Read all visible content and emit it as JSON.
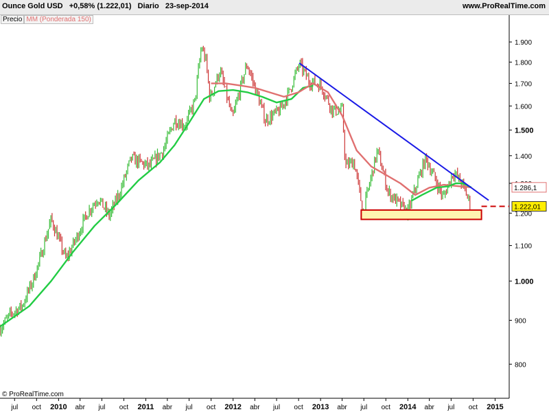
{
  "header": {
    "instrument": "Ounce Gold USD",
    "change": "+0,58% (1.222,01)",
    "period": "Diario",
    "date": "23-sep-2014",
    "site": "www.ProRealTime.com"
  },
  "legend": {
    "price": "Precio",
    "ma": "MM (Ponderada 150)"
  },
  "copyright": "© ProRealTime.com",
  "colors": {
    "ma_green": "#22cc44",
    "ma_red": "#e07070",
    "trendline": "#1a1ae6",
    "support": "#cc0000",
    "support_fill": "#fff4b0",
    "candle_up": "#33bb33",
    "candle_down": "#cc3333"
  },
  "chart_data": {
    "type": "line",
    "title": "Ounce Gold USD",
    "x_range": [
      "2009-05",
      "2015-03"
    ],
    "ylim": [
      730,
      1990
    ],
    "y_scale": "log",
    "grid": false,
    "price_series": {
      "name": "Precio",
      "x": [
        "2009-05-01",
        "2009-06-15",
        "2009-08-01",
        "2009-09-15",
        "2009-10-15",
        "2009-12-01",
        "2010-02-01",
        "2010-03-15",
        "2010-05-01",
        "2010-06-15",
        "2010-08-01",
        "2010-09-15",
        "2010-11-01",
        "2011-01-15",
        "2011-03-15",
        "2011-05-01",
        "2011-06-15",
        "2011-07-25",
        "2011-08-22",
        "2011-09-10",
        "2011-09-26",
        "2011-11-07",
        "2011-12-29",
        "2012-02-28",
        "2012-05-15",
        "2012-07-15",
        "2012-08-22",
        "2012-10-04",
        "2012-11-15",
        "2013-01-02",
        "2013-02-20",
        "2013-04-02",
        "2013-04-15",
        "2013-05-20",
        "2013-06-28",
        "2013-08-27",
        "2013-10-10",
        "2013-12-31",
        "2014-02-20",
        "2014-03-17",
        "2014-05-29",
        "2014-07-10",
        "2014-08-15",
        "2014-09-23"
      ],
      "values": [
        880,
        915,
        935,
        1000,
        1060,
        1180,
        1060,
        1120,
        1200,
        1250,
        1190,
        1270,
        1390,
        1360,
        1420,
        1540,
        1520,
        1620,
        1880,
        1800,
        1630,
        1760,
        1545,
        1790,
        1540,
        1580,
        1660,
        1790,
        1710,
        1690,
        1580,
        1580,
        1360,
        1380,
        1200,
        1420,
        1270,
        1200,
        1330,
        1390,
        1250,
        1340,
        1300,
        1222
      ]
    },
    "moving_averages": [
      {
        "name": "MM (Ponderada 150)",
        "color": "#22cc44",
        "x": [
          "2009-05-01",
          "2009-09-01",
          "2009-12-01",
          "2010-03-01",
          "2010-06-01",
          "2010-09-01",
          "2010-12-01",
          "2011-03-01",
          "2011-05-01",
          "2011-07-01",
          "2011-09-01",
          "2011-11-01",
          "2012-01-01",
          "2012-03-01",
          "2012-05-01",
          "2012-07-01",
          "2012-09-01",
          "2012-10-20",
          "2012-12-01"
        ],
        "values": [
          885,
          935,
          1000,
          1080,
          1160,
          1230,
          1310,
          1375,
          1440,
          1530,
          1630,
          1665,
          1670,
          1660,
          1640,
          1615,
          1630,
          1680,
          1690
        ]
      },
      {
        "name": "MM (Ponderada 150)",
        "color": "#e07070",
        "x": [
          "2011-10-01",
          "2011-12-01",
          "2012-02-01",
          "2012-04-01",
          "2012-06-01",
          "2012-08-01",
          "2012-10-01",
          "2012-12-01",
          "2013-02-01",
          "2013-04-01",
          "2013-06-01",
          "2013-08-01",
          "2013-10-01",
          "2013-12-01",
          "2014-02-01",
          "2014-04-01",
          "2014-06-01",
          "2014-08-01",
          "2014-09-23"
        ],
        "values": [
          1700,
          1700,
          1690,
          1680,
          1660,
          1640,
          1660,
          1700,
          1660,
          1560,
          1420,
          1360,
          1330,
          1300,
          1260,
          1285,
          1295,
          1290,
          1286
        ]
      },
      {
        "name": "",
        "color": "#22cc44",
        "x": [
          "2014-01-15",
          "2014-03-01",
          "2014-05-01",
          "2014-06-20",
          "2014-07-20",
          "2014-08-20",
          "2014-09-23"
        ],
        "values": [
          1240,
          1260,
          1285,
          1290,
          1300,
          1300,
          1286
        ]
      }
    ],
    "trendline": {
      "x": [
        "2012-10-04",
        "2014-12-05"
      ],
      "y": [
        1795,
        1242
      ]
    },
    "support_zone": {
      "x": [
        "2013-06-20",
        "2014-11-05"
      ],
      "y": [
        1180,
        1210
      ]
    },
    "current_level": {
      "value": 1222,
      "label": "1.222,01"
    },
    "ma_level": {
      "value": 1286,
      "label": "1.286,1"
    },
    "y_ticks": [
      {
        "v": 800,
        "label": "800"
      },
      {
        "v": 900,
        "label": "900"
      },
      {
        "v": 1000,
        "label": "1.000",
        "bold": true
      },
      {
        "v": 1100,
        "label": "1.100"
      },
      {
        "v": 1200,
        "label": "1.200"
      },
      {
        "v": 1300,
        "label": "1.300"
      },
      {
        "v": 1400,
        "label": "1.400"
      },
      {
        "v": 1500,
        "label": "1.500",
        "bold": true
      },
      {
        "v": 1600,
        "label": "1.600"
      },
      {
        "v": 1700,
        "label": "1.700"
      },
      {
        "v": 1800,
        "label": "1.800"
      },
      {
        "v": 1900,
        "label": "1.900"
      }
    ],
    "x_ticks": [
      {
        "d": "2009-07-01",
        "label": "jul"
      },
      {
        "d": "2009-10-01",
        "label": "oct"
      },
      {
        "d": "2010-01-01",
        "label": "2010",
        "bold": true
      },
      {
        "d": "2010-04-01",
        "label": "abr"
      },
      {
        "d": "2010-07-01",
        "label": "jul"
      },
      {
        "d": "2010-10-01",
        "label": "oct"
      },
      {
        "d": "2011-01-01",
        "label": "2011",
        "bold": true
      },
      {
        "d": "2011-04-01",
        "label": "abr"
      },
      {
        "d": "2011-07-01",
        "label": "jul"
      },
      {
        "d": "2011-10-01",
        "label": "oct"
      },
      {
        "d": "2012-01-01",
        "label": "2012",
        "bold": true
      },
      {
        "d": "2012-04-01",
        "label": "abr"
      },
      {
        "d": "2012-07-01",
        "label": "jul"
      },
      {
        "d": "2012-10-01",
        "label": "oct"
      },
      {
        "d": "2013-01-01",
        "label": "2013",
        "bold": true
      },
      {
        "d": "2013-04-01",
        "label": "abr"
      },
      {
        "d": "2013-07-01",
        "label": "jul"
      },
      {
        "d": "2013-10-01",
        "label": "oct"
      },
      {
        "d": "2014-01-01",
        "label": "2014",
        "bold": true
      },
      {
        "d": "2014-04-01",
        "label": "abr"
      },
      {
        "d": "2014-07-01",
        "label": "jul"
      },
      {
        "d": "2014-10-01",
        "label": "oct"
      },
      {
        "d": "2015-01-01",
        "label": "2015",
        "bold": true
      }
    ]
  }
}
